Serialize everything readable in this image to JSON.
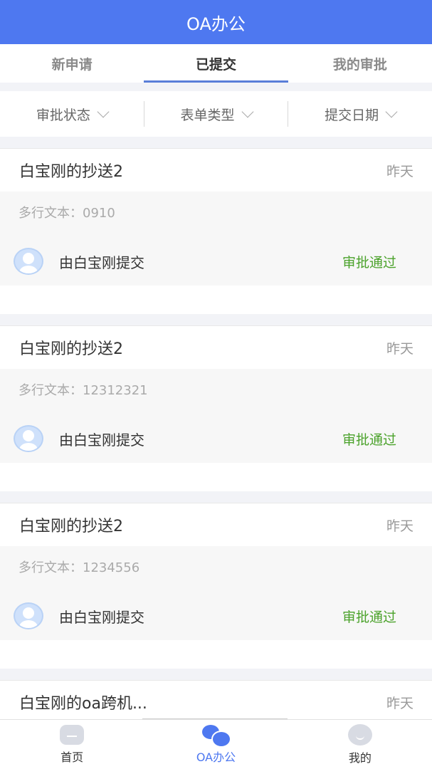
{
  "header": {
    "title": "OA办公"
  },
  "tabs": [
    {
      "label": "新申请",
      "active": false
    },
    {
      "label": "已提交",
      "active": true
    },
    {
      "label": "我的审批",
      "active": false
    }
  ],
  "filters": [
    {
      "label": "审批状态"
    },
    {
      "label": "表单类型"
    },
    {
      "label": "提交日期"
    }
  ],
  "cards": [
    {
      "title": "白宝刚的抄送2",
      "time": "昨天",
      "desc": "多行文本：0910",
      "submitter": "由白宝刚提交",
      "status": "审批通过"
    },
    {
      "title": "白宝刚的抄送2",
      "time": "昨天",
      "desc": "多行文本：12312321",
      "submitter": "由白宝刚提交",
      "status": "审批通过"
    },
    {
      "title": "白宝刚的抄送2",
      "time": "昨天",
      "desc": "多行文本：1234556",
      "submitter": "由白宝刚提交",
      "status": "审批通过"
    },
    {
      "title": "白宝刚的oa跨机...",
      "time": "昨天"
    }
  ],
  "colors": {
    "primary": "#4e78f0",
    "approved": "#4ba22b"
  },
  "bottom_nav": [
    {
      "label": "首页",
      "icon": "home-icon"
    },
    {
      "label": "OA办公",
      "icon": "chat-icon",
      "active": true
    },
    {
      "label": "我的",
      "icon": "profile-icon"
    }
  ]
}
